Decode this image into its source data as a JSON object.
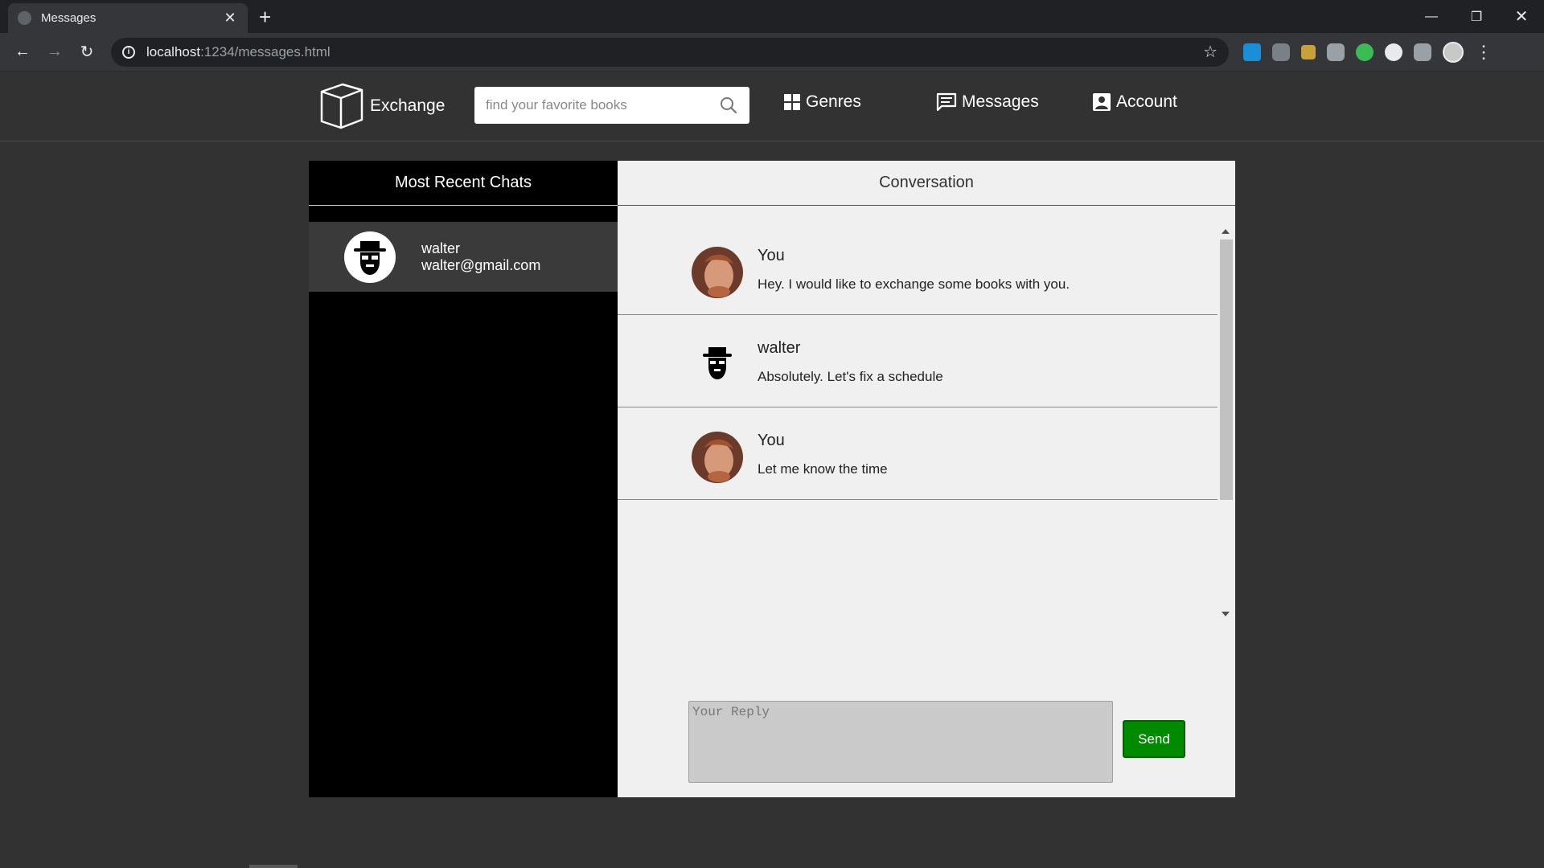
{
  "browser": {
    "tab_title": "Messages",
    "url_host": "localhost",
    "url_path": ":1234/messages.html"
  },
  "site": {
    "brand": "Exchange",
    "search_placeholder": "find your favorite books",
    "nav": {
      "genres": "Genres",
      "messages": "Messages",
      "account": "Account"
    }
  },
  "chats": {
    "heading": "Most Recent Chats",
    "items": [
      {
        "name": "walter",
        "email": "walter@gmail.com"
      }
    ]
  },
  "conversation": {
    "heading": "Conversation",
    "messages": [
      {
        "sender": "You",
        "text": "Hey. I would like to exchange some books with you."
      },
      {
        "sender": "walter",
        "text": "Absolutely. Let's fix a schedule"
      },
      {
        "sender": "You",
        "text": "Let me know the time"
      }
    ],
    "reply_placeholder": "Your Reply",
    "send_label": "Send"
  },
  "colors": {
    "send_button": "#008a00",
    "chats_panel": "#000000",
    "convo_panel": "#f0f0f0"
  }
}
